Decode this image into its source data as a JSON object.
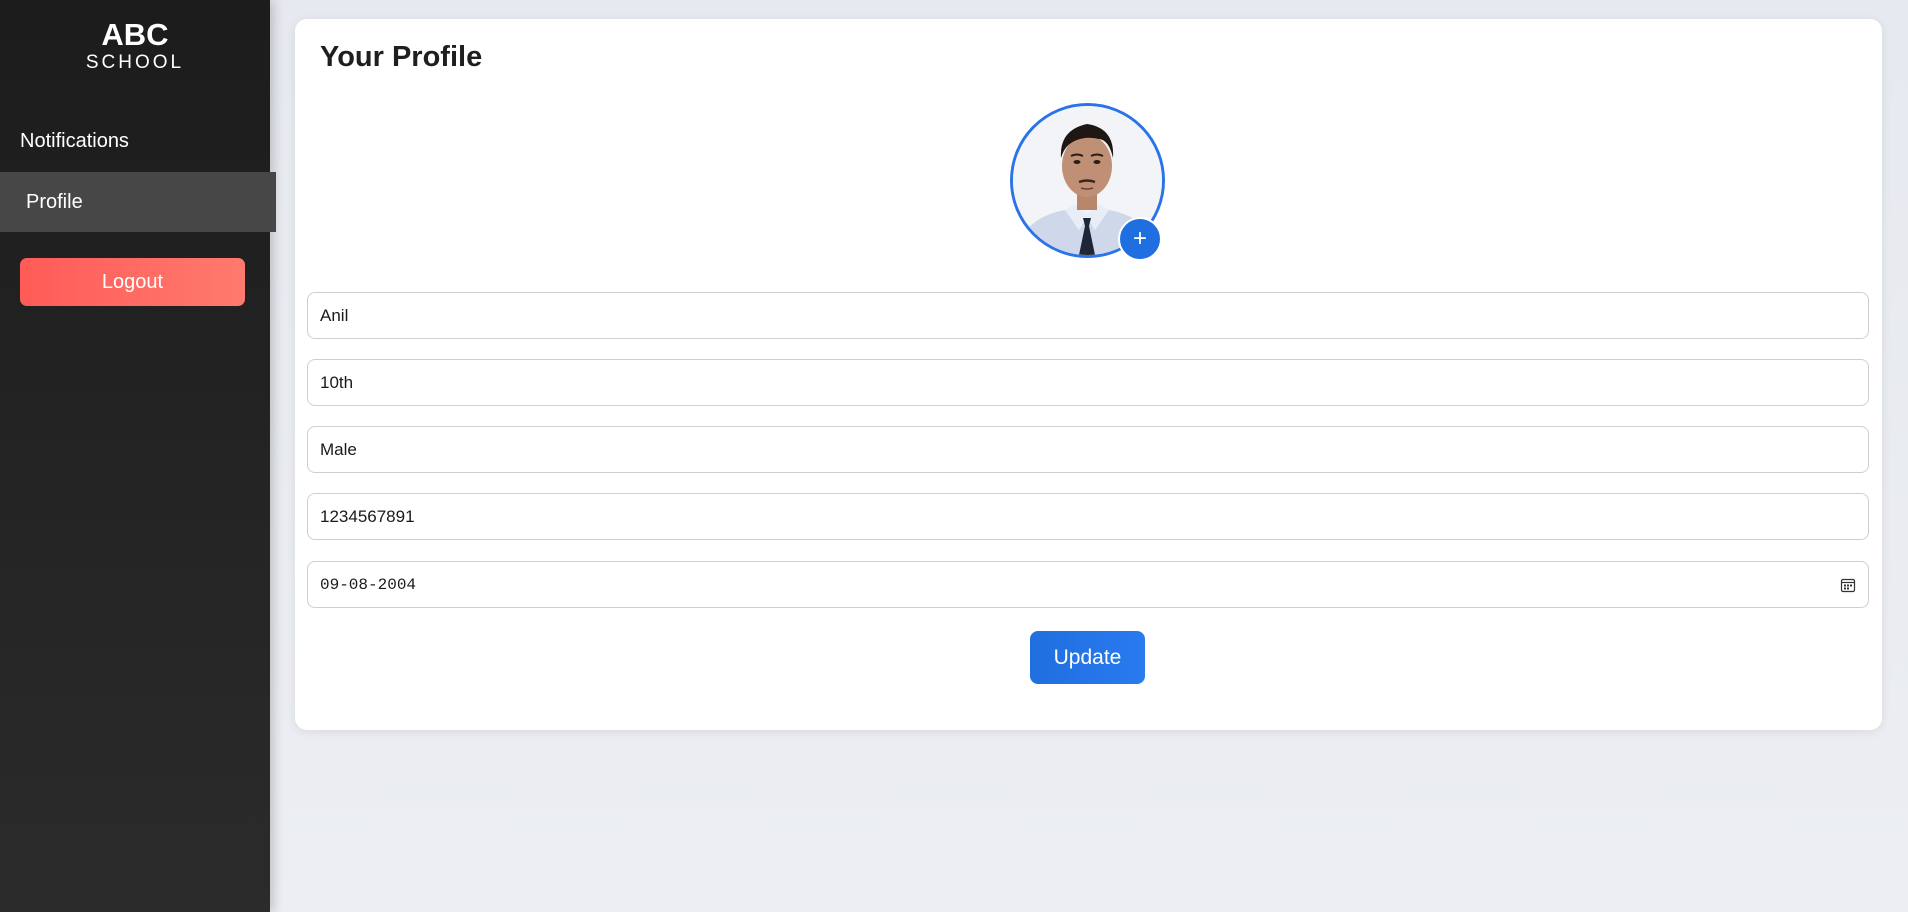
{
  "sidebar": {
    "brand_main": "ABC",
    "brand_sub": "SCHOOL",
    "items": [
      {
        "label": "Notifications"
      },
      {
        "label": "Profile"
      }
    ],
    "logout_label": "Logout"
  },
  "profile": {
    "title": "Your Profile",
    "add_photo_symbol": "+",
    "fields": {
      "name": "Anil",
      "class": "10th",
      "gender": "Male",
      "phone": "1234567891",
      "dob": "09-08-2004"
    },
    "update_label": "Update"
  },
  "colors": {
    "accent": "#1f6fe0",
    "logout": "#ff5b57",
    "sidebar_bg": "#1c1c1c"
  }
}
